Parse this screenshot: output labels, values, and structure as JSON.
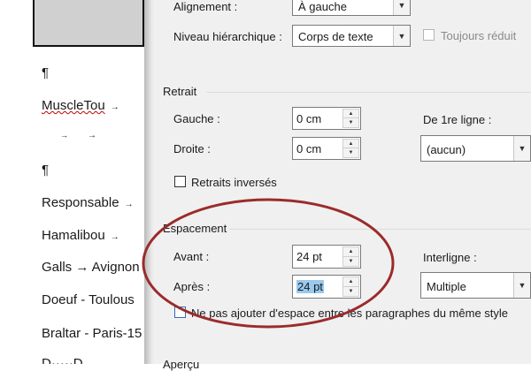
{
  "document": {
    "lines": [
      {
        "text": "¶"
      },
      {
        "text": "MuscleTou",
        "arrow": "→"
      },
      {
        "text": "→",
        "arrow": "→"
      },
      {
        "text": "¶"
      },
      {
        "text": "Responsable",
        "arrow": "→"
      },
      {
        "text": "Hamalibou",
        "arrow": "→"
      },
      {
        "text": "Galls → Avignon"
      },
      {
        "text": "Doeuf - Toulous"
      },
      {
        "text": "Braltar - Paris-15"
      },
      {
        "text": "D·····D"
      }
    ]
  },
  "dialog": {
    "alignment": {
      "label": "Alignement :",
      "value": "À gauche"
    },
    "outline_level": {
      "label": "Niveau hiérarchique :",
      "value": "Corps de texte"
    },
    "collapsed": {
      "label": "Toujours réduit"
    },
    "indent": {
      "title": "Retrait",
      "left": {
        "label": "Gauche :",
        "value": "0 cm"
      },
      "right": {
        "label": "Droite :",
        "value": "0 cm"
      },
      "first_line": {
        "label": "De 1re ligne :",
        "value": "(aucun)"
      },
      "mirror": {
        "label": "Retraits inversés"
      }
    },
    "spacing": {
      "title": "Espacement",
      "before": {
        "label": "Avant :",
        "value": "24 pt"
      },
      "after": {
        "label": "Après :",
        "value": "24 pt"
      },
      "line_spacing": {
        "label": "Interligne :",
        "value": "Multiple"
      },
      "no_space": {
        "label": "Ne pas ajouter d'espace entre les paragraphes du même style"
      }
    },
    "preview": {
      "title": "Aperçu"
    }
  },
  "colors": {
    "annotation_ellipse": "#9b2b2b",
    "selection": "#99c9ef"
  }
}
